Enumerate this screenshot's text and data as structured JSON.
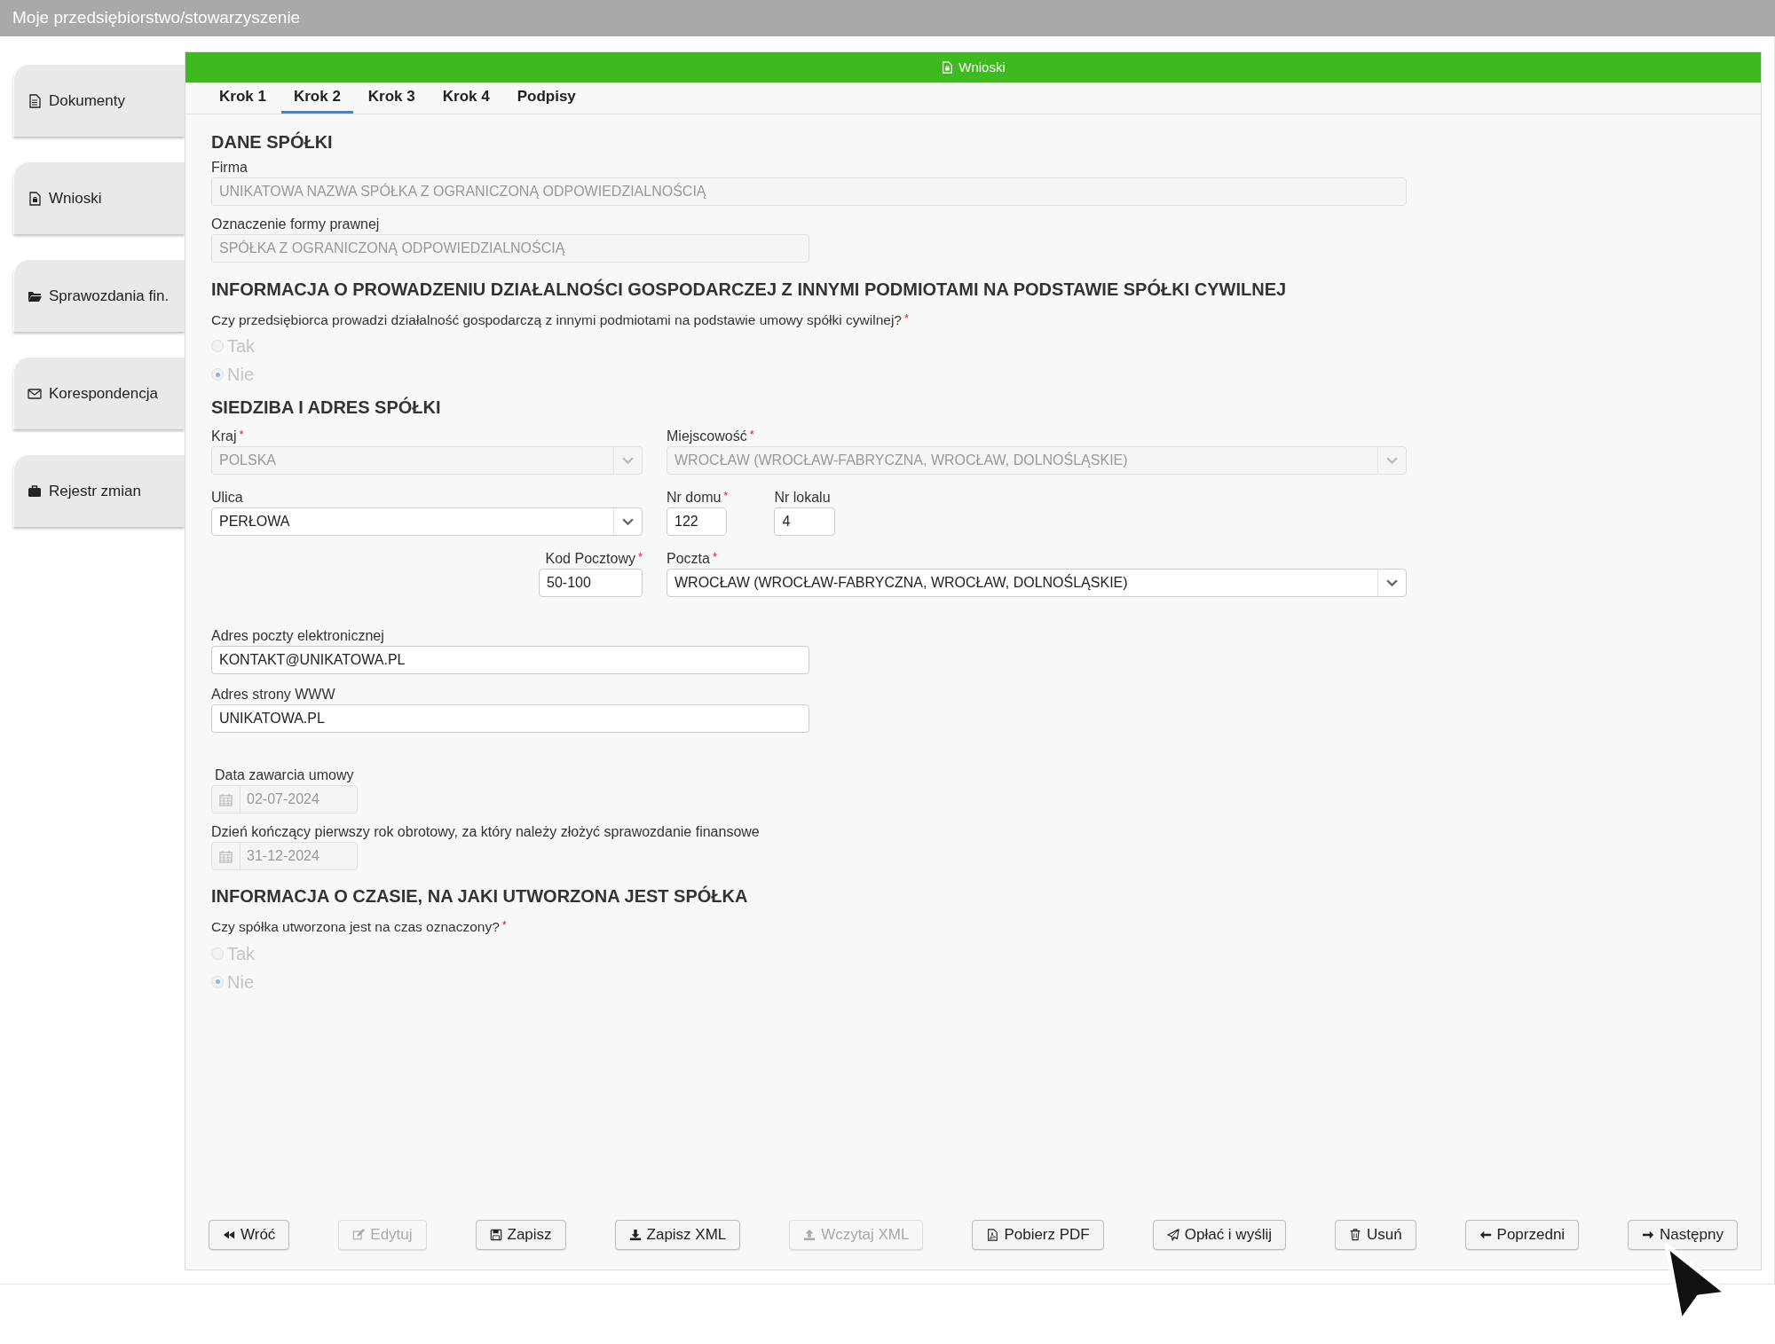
{
  "title_bar": "Moje przedsiębiorstwo/stowarzyszenie",
  "sidebar": {
    "items": [
      {
        "label": "Dokumenty"
      },
      {
        "label": "Wnioski"
      },
      {
        "label": "Sprawozdania fin."
      },
      {
        "label": "Korespondencja"
      },
      {
        "label": "Rejestr zmian"
      }
    ]
  },
  "panel": {
    "title": "Wnioski"
  },
  "tabs": [
    {
      "label": "Krok 1",
      "selected": false
    },
    {
      "label": "Krok 2",
      "selected": true
    },
    {
      "label": "Krok 3",
      "selected": false
    },
    {
      "label": "Krok 4",
      "selected": false
    },
    {
      "label": "Podpisy",
      "selected": false
    }
  ],
  "dane_spolki": {
    "heading": "DANE SPÓŁKI",
    "firma": {
      "label": "Firma",
      "value": "UNIKATOWA NAZWA SPÓŁKA Z OGRANICZONĄ ODPOWIEDZIALNOŚCIĄ",
      "disabled": true
    },
    "forma_prawna": {
      "label": "Oznaczenie formy prawnej",
      "value": "SPÓŁKA Z OGRANICZONĄ ODPOWIEDZIALNOŚCIĄ",
      "disabled": true
    }
  },
  "spolka_cywilna": {
    "heading": "INFORMACJA O PROWADZENIU DZIAŁALNOŚCI GOSPODARCZEJ Z INNYMI PODMIOTAMI NA PODSTAWIE SPÓŁKI CYWILNEJ",
    "question": "Czy przedsiębiorca prowadzi działalność gospodarczą z innymi podmiotami na podstawie umowy spółki cywilnej?",
    "required_mark": "*",
    "disabled": true,
    "options": [
      {
        "label": "Tak",
        "selected": false
      },
      {
        "label": "Nie",
        "selected": true
      }
    ]
  },
  "siedziba": {
    "heading": "SIEDZIBA I ADRES SPÓŁKI",
    "kraj": {
      "label": "Kraj",
      "required_mark": "*",
      "value": "POLSKA",
      "disabled": true
    },
    "miejscowosc": {
      "label": "Miejscowość",
      "required_mark": "*",
      "value": "WROCŁAW (WROCŁAW-FABRYCZNA, WROCŁAW, DOLNOŚLĄSKIE)",
      "disabled": true
    },
    "ulica": {
      "label": "Ulica",
      "value": "PERŁOWA",
      "disabled": false
    },
    "nr_domu": {
      "label": "Nr domu",
      "required_mark": "*",
      "value": "122",
      "disabled": false
    },
    "nr_lokalu": {
      "label": "Nr lokalu",
      "value": "4",
      "disabled": false
    },
    "kod_pocztowy": {
      "label": "Kod Pocztowy",
      "required_mark": "*",
      "value": "50-100",
      "disabled": false
    },
    "poczta": {
      "label": "Poczta",
      "required_mark": "*",
      "value": "WROCŁAW (WROCŁAW-FABRYCZNA, WROCŁAW, DOLNOŚLĄSKIE)",
      "disabled": false
    }
  },
  "email": {
    "label": "Adres poczty elektronicznej",
    "value": "KONTAKT@UNIKATOWA.PL",
    "disabled": false
  },
  "www": {
    "label": "Adres strony WWW",
    "value": "UNIKATOWA.PL",
    "disabled": false
  },
  "data_zawarcia": {
    "label": "Data zawarcia umowy",
    "value": "02-07-2024",
    "disabled": true
  },
  "koniec_roku": {
    "label": "Dzień kończący pierwszy rok obrotowy, za który należy złożyć sprawozdanie finansowe",
    "value": "31-12-2024",
    "disabled": true
  },
  "czas": {
    "heading": "INFORMACJA O CZASIE, NA JAKI UTWORZONA JEST SPÓŁKA",
    "question": "Czy spółka utworzona jest na czas oznaczony?",
    "required_mark": "*",
    "disabled": true,
    "options": [
      {
        "label": "Tak",
        "selected": false
      },
      {
        "label": "Nie",
        "selected": true
      }
    ]
  },
  "buttons": [
    {
      "label": "Wróć",
      "disabled": false
    },
    {
      "label": "Edytuj",
      "disabled": true
    },
    {
      "label": "Zapisz",
      "disabled": false
    },
    {
      "label": "Zapisz XML",
      "disabled": false
    },
    {
      "label": "Wczytaj XML",
      "disabled": true
    },
    {
      "label": "Pobierz PDF",
      "disabled": false
    },
    {
      "label": "Opłać i wyślij",
      "disabled": false
    },
    {
      "label": "Usuń",
      "disabled": false
    },
    {
      "label": "Poprzedni",
      "disabled": false
    },
    {
      "label": "Następny",
      "disabled": false
    }
  ]
}
